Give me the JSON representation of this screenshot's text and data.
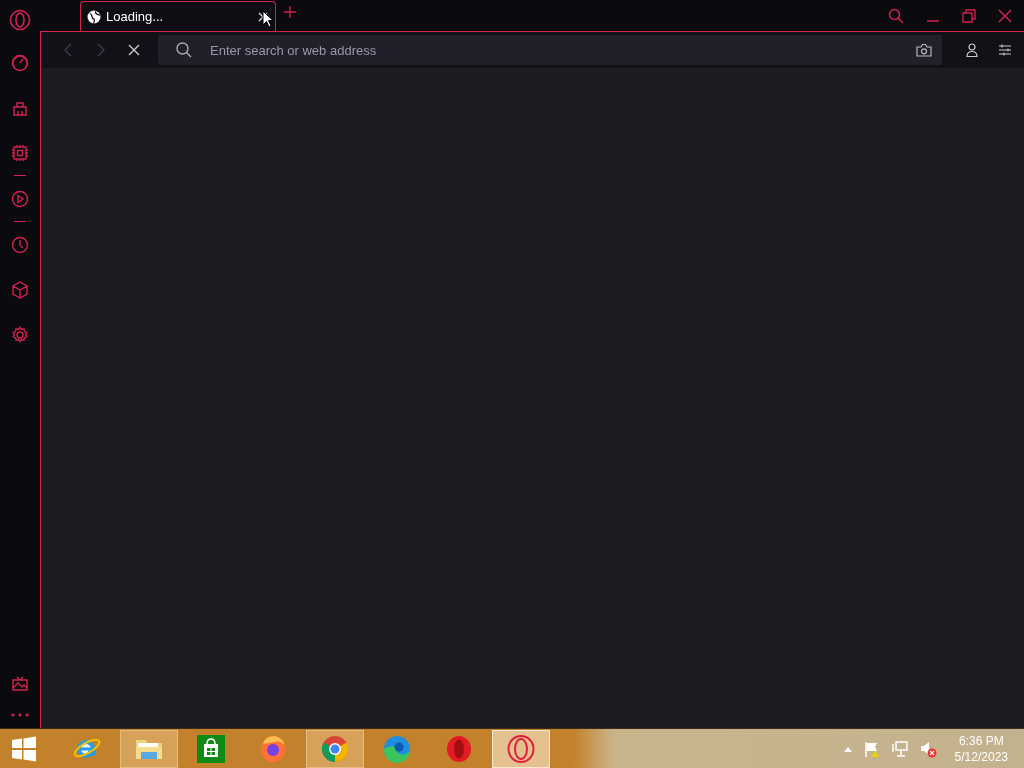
{
  "tab": {
    "title": "Loading...",
    "selected": true
  },
  "toolbar": {
    "back": {
      "disabled": true
    },
    "forward": {
      "disabled": true
    },
    "address": {
      "placeholder": "Enter search or web address"
    }
  },
  "taskbar": {
    "apps": [
      {
        "kind": "ie",
        "running": false,
        "selected": false
      },
      {
        "kind": "explorer",
        "running": true,
        "selected": false
      },
      {
        "kind": "store",
        "running": false,
        "selected": false
      },
      {
        "kind": "firefox",
        "running": false,
        "selected": false
      },
      {
        "kind": "chrome",
        "running": true,
        "selected": false
      },
      {
        "kind": "edge",
        "running": false,
        "selected": false
      },
      {
        "kind": "opera",
        "running": false,
        "selected": false
      },
      {
        "kind": "operagx",
        "running": true,
        "selected": true
      }
    ],
    "clock": {
      "time": "6:36 PM",
      "date": "5/12/2023"
    }
  }
}
